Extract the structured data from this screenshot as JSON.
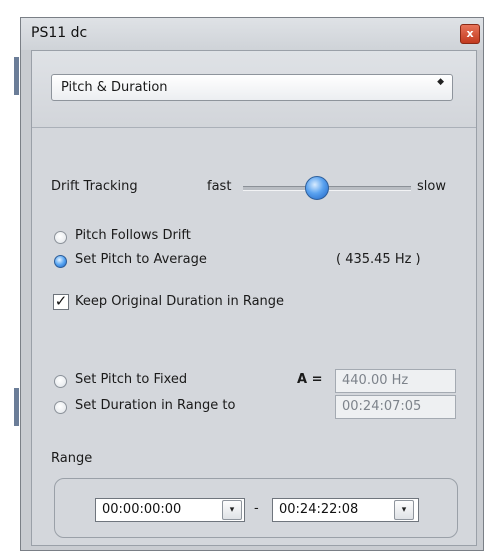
{
  "window": {
    "title": "PS11 dc",
    "close_glyph": "x"
  },
  "mode_select": {
    "value": "Pitch & Duration",
    "arrows_glyph": "◆"
  },
  "drift": {
    "label": "Drift Tracking",
    "fast_label": "fast",
    "slow_label": "slow",
    "slider_position": 0.44
  },
  "pitch_options": {
    "follows_drift": "Pitch Follows Drift",
    "set_average": "Set Pitch to Average",
    "average_readout": "( 435.45 Hz )",
    "selected": "set_average"
  },
  "keep_duration": {
    "label": "Keep Original Duration in Range",
    "checked": true,
    "check_glyph": "✓"
  },
  "fixed": {
    "set_pitch_label": "Set Pitch to Fixed",
    "a_label": "A =",
    "pitch_value": "440.00 Hz",
    "set_duration_label": "Set Duration in Range to",
    "duration_value": "00:24:07:05"
  },
  "range": {
    "label": "Range",
    "start": "00:00:00:00",
    "separator": "-",
    "end": "00:24:22:08",
    "dropdown_glyph": "▾"
  }
}
